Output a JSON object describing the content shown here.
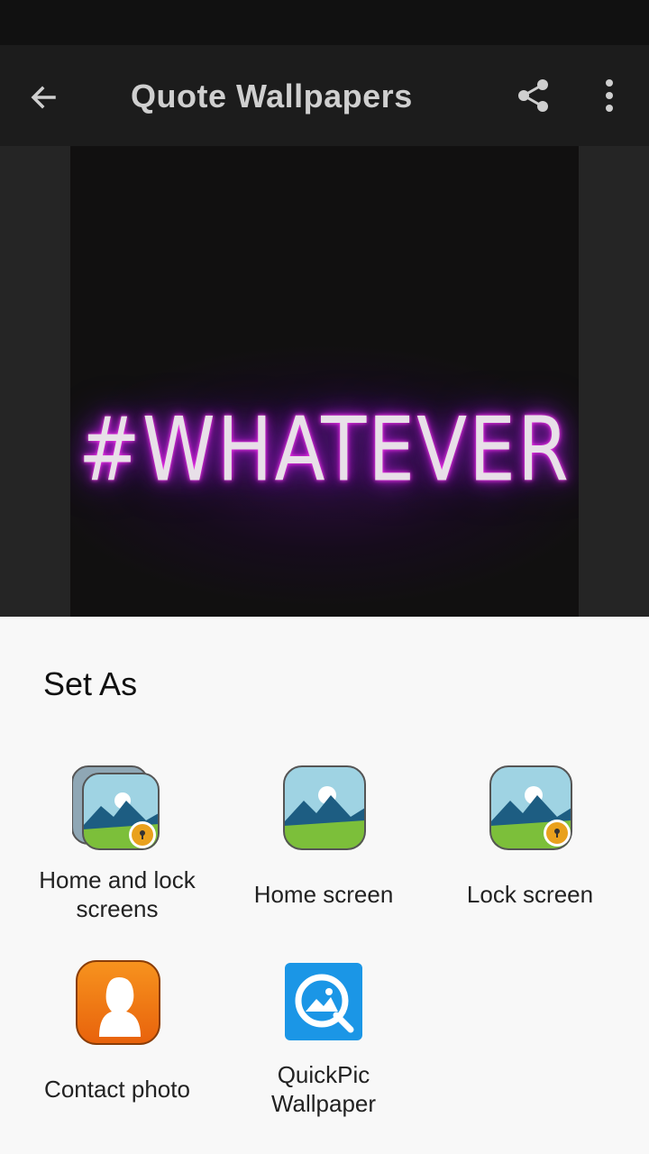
{
  "app_bar": {
    "title": "Quote Wallpapers",
    "back_icon": "arrow-back-icon",
    "share_icon": "share-icon",
    "more_icon": "more-vertical-icon"
  },
  "wallpaper": {
    "text": "#WHATEVER",
    "glow_color": "#c21ad8"
  },
  "sheet": {
    "title": "Set As",
    "options": [
      {
        "label_lines": [
          "Home and lock",
          "screens"
        ],
        "icon": "home-and-lock-wallpaper-icon"
      },
      {
        "label_lines": [
          "Home screen"
        ],
        "icon": "home-wallpaper-icon"
      },
      {
        "label_lines": [
          "Lock screen"
        ],
        "icon": "lock-wallpaper-icon"
      },
      {
        "label_lines": [
          "Contact photo"
        ],
        "icon": "contact-photo-icon"
      },
      {
        "label_lines": [
          "QuickPic",
          "Wallpaper"
        ],
        "icon": "quickpic-icon"
      }
    ]
  }
}
